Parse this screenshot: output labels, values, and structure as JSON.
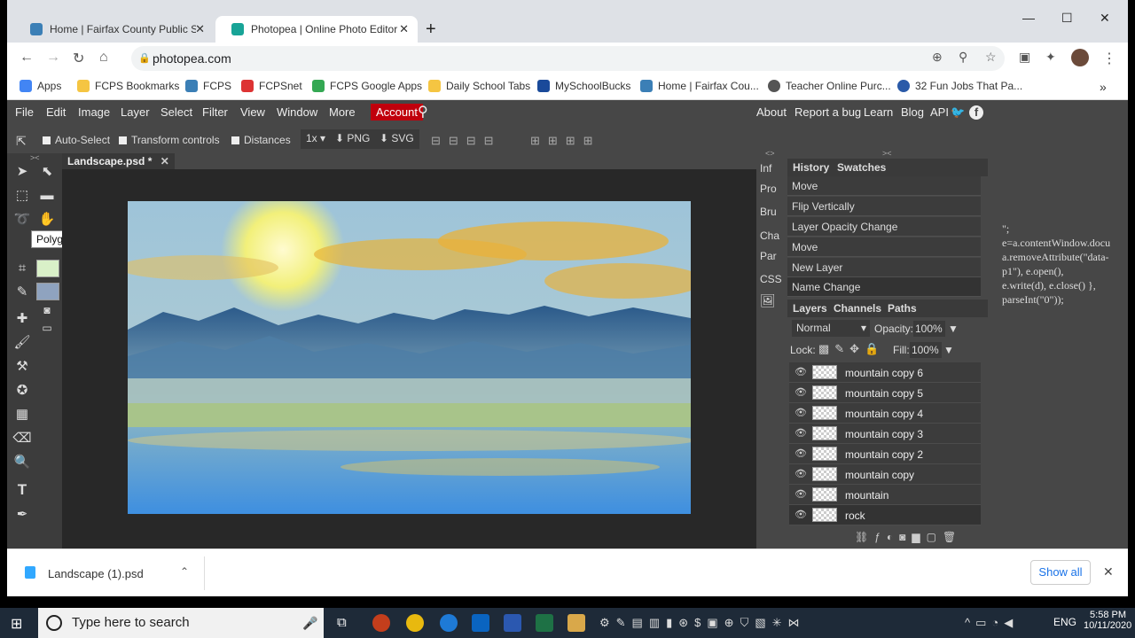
{
  "browser": {
    "tabs": [
      {
        "title": "Home | Fairfax County Public Sch",
        "active": false
      },
      {
        "title": "Photopea | Online Photo Editor",
        "active": true
      }
    ],
    "url": "photopea.com",
    "bookmarks": [
      "Apps",
      "FCPS Bookmarks",
      "FCPS",
      "FCPSnet",
      "FCPS Google Apps",
      "Daily School Tabs",
      "MySchoolBucks",
      "Home | Fairfax Cou...",
      "Teacher Online Purc...",
      "32 Fun Jobs That Pa..."
    ]
  },
  "photopea": {
    "menu": [
      "File",
      "Edit",
      "Image",
      "Layer",
      "Select",
      "Filter",
      "View",
      "Window",
      "More"
    ],
    "account": "Account",
    "right_menu": [
      "About",
      "Report a bug",
      "Learn",
      "Blog",
      "API"
    ],
    "options": {
      "auto_select": "Auto-Select",
      "transform_controls": "Transform controls",
      "distances": "Distances",
      "zoom": "1x",
      "png": "PNG",
      "svg": "SVG"
    },
    "tooltip": "Polygonal Lasso Select (L)",
    "doc_tab": "Landscape.psd *",
    "side_labels": [
      "Inf",
      "Pro",
      "Bru",
      "Cha",
      "Par",
      "CSS"
    ],
    "history_tabs": [
      "History",
      "Swatches"
    ],
    "history": [
      "Move",
      "Flip Vertically",
      "Layer Opacity Change",
      "Move",
      "New Layer",
      "Name Change"
    ],
    "layer_tabs": [
      "Layers",
      "Channels",
      "Paths"
    ],
    "blend_mode": "Normal",
    "opacity_label": "Opacity:",
    "opacity": "100%",
    "lock_label": "Lock:",
    "fill_label": "Fill:",
    "fill": "100%",
    "layers": [
      "mountain copy 6",
      "mountain copy 5",
      "mountain copy 4",
      "mountain copy 3",
      "mountain copy 2",
      "mountain copy",
      "mountain",
      "rock"
    ],
    "code_snippet": "\";\ne=a.contentWindow.docu\na.removeAttribute(\"data-\np1\"), e.open(),\ne.write(d), e.close() },\nparseInt(\"0\"));"
  },
  "downloads": {
    "file": "Landscape (1).psd",
    "show_all": "Show all"
  },
  "taskbar": {
    "search_placeholder": "Type here to search",
    "lang": "ENG",
    "time": "5:58 PM",
    "date": "10/11/2020"
  },
  "colors": {
    "account_red": "#c0000c",
    "panel_bg": "#474747",
    "accent_blue": "#1a73e8"
  }
}
